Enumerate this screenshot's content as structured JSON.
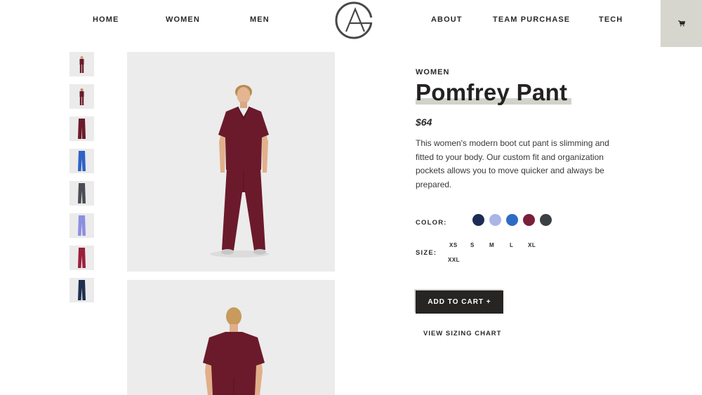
{
  "nav": {
    "left": [
      "HOME",
      "WOMEN",
      "MEN"
    ],
    "right": [
      "ABOUT",
      "TEAM PURCHASE",
      "TECH"
    ],
    "logo_text": "GA",
    "cart_icon": "cart-icon"
  },
  "thumbnails": [
    {
      "color": "#6b1a2b",
      "kind": "full-front"
    },
    {
      "color": "#6b1a2b",
      "kind": "full-back"
    },
    {
      "color": "#6b1a2b",
      "kind": "pant-detail"
    },
    {
      "color": "#2f62c6",
      "kind": "pant"
    },
    {
      "color": "#4a4d55",
      "kind": "pant"
    },
    {
      "color": "#8c8fe0",
      "kind": "pant"
    },
    {
      "color": "#9b1f3a",
      "kind": "pant"
    },
    {
      "color": "#1f2f4e",
      "kind": "pant"
    }
  ],
  "product": {
    "category": "WOMEN",
    "title": "Pomfrey Pant",
    "price": "$64",
    "description": "This women's modern boot cut pant is slimming and fitted to your body. Our custom fit and organization pockets allows you to move quicker and always be prepared.",
    "color_label": "COLOR:",
    "colors": [
      "#1d2c55",
      "#aab6e6",
      "#2e6cc4",
      "#7a2038",
      "#3b4143"
    ],
    "size_label": "SIZE:",
    "sizes": [
      "XS",
      "S",
      "M",
      "L",
      "XL",
      "XXL"
    ],
    "add_to_cart": "ADD TO CART +",
    "sizing_chart": "VIEW SIZING CHART"
  },
  "theme": {
    "scrub_color": "#6b1a2b",
    "accent": "#d6d6cf",
    "button_bg": "#272424"
  }
}
